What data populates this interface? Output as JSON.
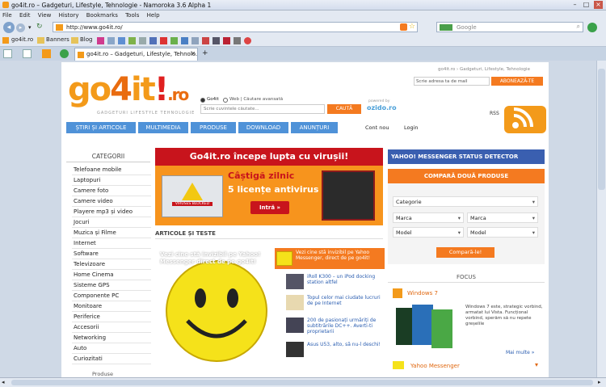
{
  "window": {
    "title": "go4it.ro – Gadgeturi, Lifestyle, Tehnologie - Namoroka 3.6 Alpha 1"
  },
  "menu": [
    "File",
    "Edit",
    "View",
    "History",
    "Bookmarks",
    "Tools",
    "Help"
  ],
  "nav": {
    "url": "http://www.go4it.ro/",
    "search_placeholder": "Google"
  },
  "bookmarks": [
    "go4it.ro",
    "Banners",
    "Blog"
  ],
  "tab": {
    "label": "go4it.ro – Gadgeturi, Lifestyle, Tehnolo..."
  },
  "site": {
    "logo_go": "go",
    "logo_4": "4",
    "logo_it": "it",
    "logo_excl": "!",
    "logo_ro": ".ro",
    "tagline": "GADGETURI LIFESTYLE TEHNOLOGIE",
    "breadcrumb": "go4it.ro › Gadgeturi, Lifestyle, Tehnologie",
    "newsletter_placeholder": "Scrie adresa ta de mail",
    "newsletter_btn": "ABONEAZĂ-TE",
    "search_opt1": "Go4it",
    "search_opt2": "Web | Căutare avansată",
    "search_placeholder": "Scrie cuvintele căutate...",
    "search_btn": "CAUTĂ",
    "powered": "powered by",
    "ozido": "ozido.ro",
    "rss": "RSS",
    "navbuttons": [
      "ȘTIRI ȘI ARTICOLE",
      "MULTIMEDIA",
      "PRODUSE",
      "DOWNLOAD",
      "ANUNȚURI"
    ],
    "cont_nou": "Cont nou",
    "login": "Login"
  },
  "sidebar": {
    "heading": "CATEGORII",
    "items": [
      "Telefoane mobile",
      "Laptopuri",
      "Camere foto",
      "Camere video",
      "Playere mp3 și video",
      "Jocuri",
      "Muzica și Filme",
      "Internet",
      "Software",
      "Televizoare",
      "Home Cinema",
      "Sisteme GPS",
      "Componente PC",
      "Monitoare",
      "Periferice",
      "Accesorii",
      "Networking",
      "Auto",
      "Curiozitati"
    ],
    "footer": "Produse"
  },
  "banner": {
    "headline": "Go4it.ro începe lupta cu virușii!",
    "line1": "Câștigă zilnic",
    "line2": "5 licențe antivirus",
    "cta": "Intră »",
    "badge": "VIRUSES BLOCKED"
  },
  "articles": {
    "heading": "ARTICOLE ȘI TESTE",
    "feature": "Vezi cine stă invizibil pe Yahoo! Messenger direct de pe go4it!",
    "list": [
      "Vezi cine stă invizibil pe Yahoo Messenger, direct de pe go4it!",
      "iRoll K300 – un iPod docking station altfel",
      "Topul celor mai ciudate lucruri de pe Internet",
      "200 de pasionați urmăriți de subtitrările DC++. Averti-ti proprietarii",
      "Asus U53, alto, să nu-l deschi!"
    ]
  },
  "right": {
    "yahoo_title": "YAHOO! MESSENGER STATUS DETECTOR",
    "compare_title": "COMPARĂ DOUĂ PRODUSE",
    "categoria": "Categorie",
    "marca1": "Marca",
    "marca2": "Marca",
    "model1": "Model",
    "model2": "Model",
    "compare_btn": "Compară-le!",
    "focus": "FOCUS",
    "win7_title": "Windows 7",
    "win7_text": "Windows 7 este, strategic vorbind, armatat lui Vista. Funcțional vorbind, sperăm să nu repete greșelile",
    "more": "Mai multe »",
    "yahoo_focus": "Yahoo Messenger"
  },
  "colors": {
    "orange": "#f47a20",
    "blue": "#4f92d8"
  }
}
